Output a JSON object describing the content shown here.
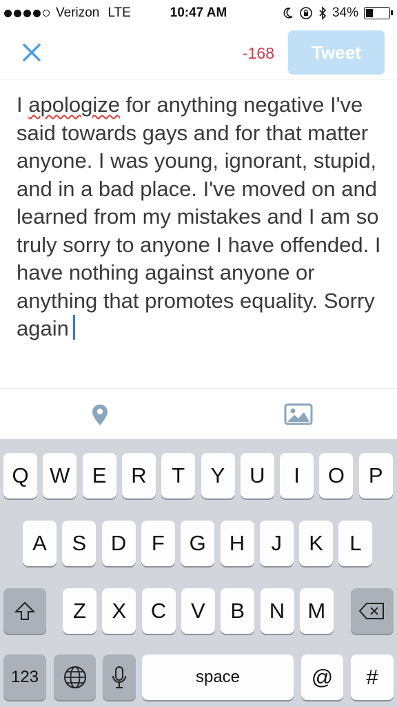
{
  "status_bar": {
    "carrier": "Verizon",
    "network": "LTE",
    "time": "10:47 AM",
    "battery": "34%",
    "battery_level": 0.34
  },
  "compose": {
    "char_count": "-168",
    "tweet_label": "Tweet",
    "misspelled_word": "apologize",
    "text_before": "I ",
    "text_after": " for anything negative I've said towards gays and for that matter anyone. I was young, ignorant, stupid, and in a bad place. I've moved on and learned from my mistakes and I am so truly sorry to anyone I have offended. I have nothing against anyone or anything that promotes equality. Sorry again"
  },
  "toolbar": {
    "location_icon": "location-pin-icon",
    "photo_icon": "photo-icon"
  },
  "keyboard": {
    "row1": [
      "Q",
      "W",
      "E",
      "R",
      "T",
      "Y",
      "U",
      "I",
      "O",
      "P"
    ],
    "row2": [
      "A",
      "S",
      "D",
      "F",
      "G",
      "H",
      "J",
      "K",
      "L"
    ],
    "row3": [
      "Z",
      "X",
      "C",
      "V",
      "B",
      "N",
      "M"
    ],
    "numbers_label": "123",
    "space_label": "space",
    "at_label": "@",
    "hash_label": "#"
  }
}
